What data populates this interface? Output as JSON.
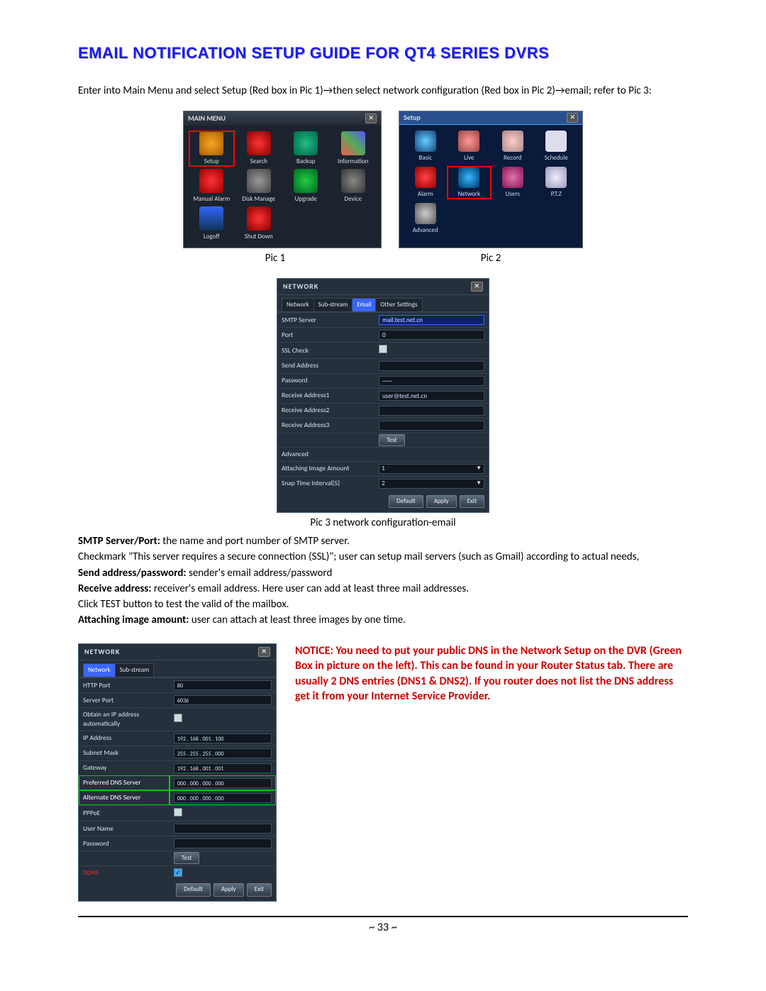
{
  "title": "EMAIL NOTIFICATION SETUP GUIDE FOR QT4 SERIES DVRS",
  "intro": "Enter into Main Menu and select Setup (Red box in Pic 1)→then select network configuration (Red box in Pic 2)→email; refer to Pic 3:",
  "pic1": {
    "bar": "MAIN  MENU",
    "items": [
      "Setup",
      "Search",
      "Backup",
      "Information",
      "Manual Alarm",
      "Disk Manage",
      "Upgrade",
      "Device",
      "Logoff",
      "Shut Down"
    ],
    "caption": "Pic 1"
  },
  "pic2": {
    "bar": "Setup",
    "items": [
      "Basic",
      "Live",
      "Record",
      "Schedule",
      "Alarm",
      "Network",
      "Users",
      "P.T.Z",
      "Advanced"
    ],
    "caption": "Pic 2"
  },
  "pic3": {
    "bar": "NETWORK",
    "tabs": [
      "Network",
      "Sub-stream",
      "Email",
      "Other Settings"
    ],
    "active_tab": "Email",
    "rows": {
      "smtp_label": "SMTP Server",
      "smtp_val": "mail.test.net.cn",
      "port_label": "Port",
      "port_val": "0",
      "ssl_label": "SSL Check",
      "send_label": "Send Address",
      "send_val": "",
      "pwd_label": "Password",
      "pwd_val": "······",
      "r1_label": "Receive Address1",
      "r1_val": "user@test.net.cn",
      "r2_label": "Receive Address2",
      "r2_val": "",
      "r3_label": "Receive Address3",
      "r3_val": "",
      "test_btn": "Test",
      "adv_label": "Advanced",
      "att_label": "Attaching Image Amount",
      "att_val": "1",
      "snap_label": "Snap Time Interval[S]",
      "snap_val": "2",
      "default": "Default",
      "apply": "Apply",
      "exit": "Exit"
    },
    "caption": "Pic 3 network configuration-email"
  },
  "body": {
    "l1a": "SMTP Server/Port:",
    "l1b": " the name and port number of SMTP server.",
    "l2": "Checkmark \"This server requires a secure connection (SSL)\"; user can setup mail servers (such as Gmail) according to actual needs,",
    "l3a": "Send address/password:",
    "l3b": " sender's email address/password",
    "l4a": "Receive address:",
    "l4b": " receiver's email address. Here user can add at least three mail addresses.",
    "l5": "Click TEST button to test the valid of the mailbox.",
    "l6a": "Attaching image amount:",
    "l6b": " user can attach at least three images by one time."
  },
  "pic4": {
    "bar": "NETWORK",
    "tabs": [
      "Network",
      "Sub-stream"
    ],
    "active_tab": "Network",
    "rows": [
      {
        "k": "HTTP Port",
        "v": "80"
      },
      {
        "k": "Server Port",
        "v": "6036"
      },
      {
        "k": "Obtain an IP address automatically",
        "v": "",
        "chk": true
      },
      {
        "k": "IP Address",
        "v": "192 . 168 . 001 . 100"
      },
      {
        "k": "Subnet Mask",
        "v": "255 . 255 . 255 . 000"
      },
      {
        "k": "Gateway",
        "v": "192 . 168 . 001 . 001"
      },
      {
        "k": "Preferred DNS Server",
        "v": "000 . 000 . 000 . 000",
        "dns": true
      },
      {
        "k": "Alternate DNS Server",
        "v": "000 . 000 . 000 . 000",
        "dns": true
      },
      {
        "k": "PPPoE",
        "v": "",
        "chk": true
      },
      {
        "k": "User Name",
        "v": ""
      },
      {
        "k": "Password",
        "v": ""
      },
      {
        "k": "",
        "v": "",
        "test": true
      },
      {
        "k": "DDNS",
        "v": "",
        "ddns": true
      }
    ],
    "test": "Test",
    "default": "Default",
    "apply": "Apply",
    "exit": "Exit"
  },
  "notice": "NOTICE: You need to put your public DNS in the Network Setup on the DVR (Green Box in picture on the left). This can be found in your Router Status tab. There are usually 2 DNS entries (DNS1 & DNS2).  If you router does not list the DNS address get it from your Internet Service Provider.",
  "page": "~ 33 ~"
}
